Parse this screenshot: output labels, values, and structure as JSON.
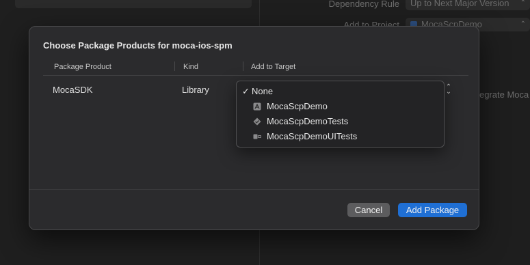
{
  "background": {
    "dependency_rule_label": "Dependency Rule",
    "dependency_rule_value": "Up to Next Major Version",
    "add_to_project_label": "Add to Project",
    "add_to_project_value": "MocaScpDemo",
    "partial_text": "egrate Moca"
  },
  "sheet": {
    "title": "Choose Package Products for moca-ios-spm",
    "columns": [
      "Package Product",
      "Kind",
      "Add to Target"
    ],
    "rows": [
      {
        "product": "MocaSDK",
        "kind": "Library",
        "target": "None"
      }
    ],
    "cancel_label": "Cancel",
    "add_label": "Add Package"
  },
  "target_menu": {
    "checkmark": "✓",
    "items": [
      {
        "label": "None",
        "icon": "none",
        "checked": true
      },
      {
        "label": "MocaScpDemo",
        "icon": "app-icon"
      },
      {
        "label": "MocaScpDemoTests",
        "icon": "test-diamond-icon"
      },
      {
        "label": "MocaScpDemoUITests",
        "icon": "ui-test-icon"
      }
    ]
  },
  "colors": {
    "accent": "#1f6fd4",
    "sheet": "#2b2b2d"
  }
}
